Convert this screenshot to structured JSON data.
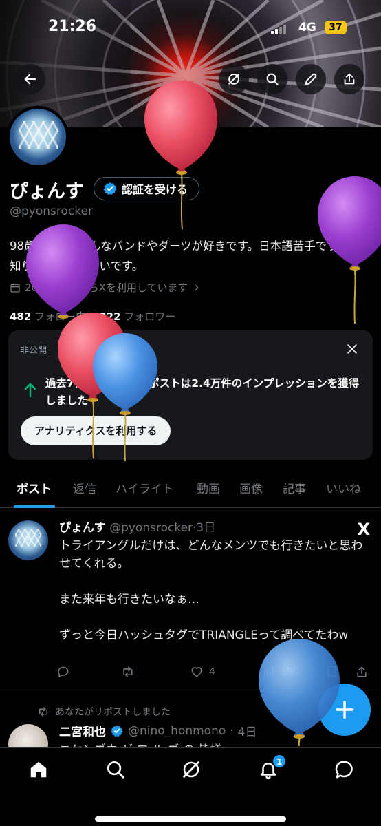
{
  "status_bar": {
    "time": "21:26",
    "network": "4G",
    "battery": "37"
  },
  "profile": {
    "name": "ぴょんす",
    "verify_button": "認証を受ける",
    "handle": "@pyonsrocker",
    "bio": "98歳/Oita/いろんなバンドやダーツが好きです。日本語苦手です。人見知りです。うるさいです。",
    "joined": "2020年7月からXを利用しています",
    "following_count": "482",
    "following_label": "フォロー中",
    "followers_count": "322",
    "followers_label": "フォロワー"
  },
  "private_card": {
    "label": "非公開",
    "message": "過去7日間にあなたのポストは2.4万件のインプレッションを獲得しました",
    "cta": "アナリティクスを利用する"
  },
  "tabs": [
    {
      "label": "ポスト"
    },
    {
      "label": "返信"
    },
    {
      "label": "ハイライト"
    },
    {
      "label": "動画"
    },
    {
      "label": "画像"
    },
    {
      "label": "記事"
    },
    {
      "label": "いいね"
    }
  ],
  "post": {
    "name": "ぴょんす",
    "handle": "@pyonsrocker",
    "time": "3日",
    "body": "トライアングルだけは、どんなメンツでも行きたいと思わせてくれる。\n\nまた来年も行きたいなぁ…\n\nずっと今日ハッシュタグでTRIANGLEって調べてたわw",
    "likes": "4",
    "views": "190",
    "x_mark": "X"
  },
  "repost": {
    "label": "あなたがリポストしました",
    "name": "二宮和也",
    "handle": "@nino_honmono",
    "time": "4日",
    "snippet": "ニセンゴウ ゼ ロ ル ゴ の 皆様"
  },
  "nav": {
    "notifications_badge": "1"
  },
  "colors": {
    "accent": "#1d9bf0",
    "background": "#000000",
    "secondary_text": "#71767b"
  }
}
